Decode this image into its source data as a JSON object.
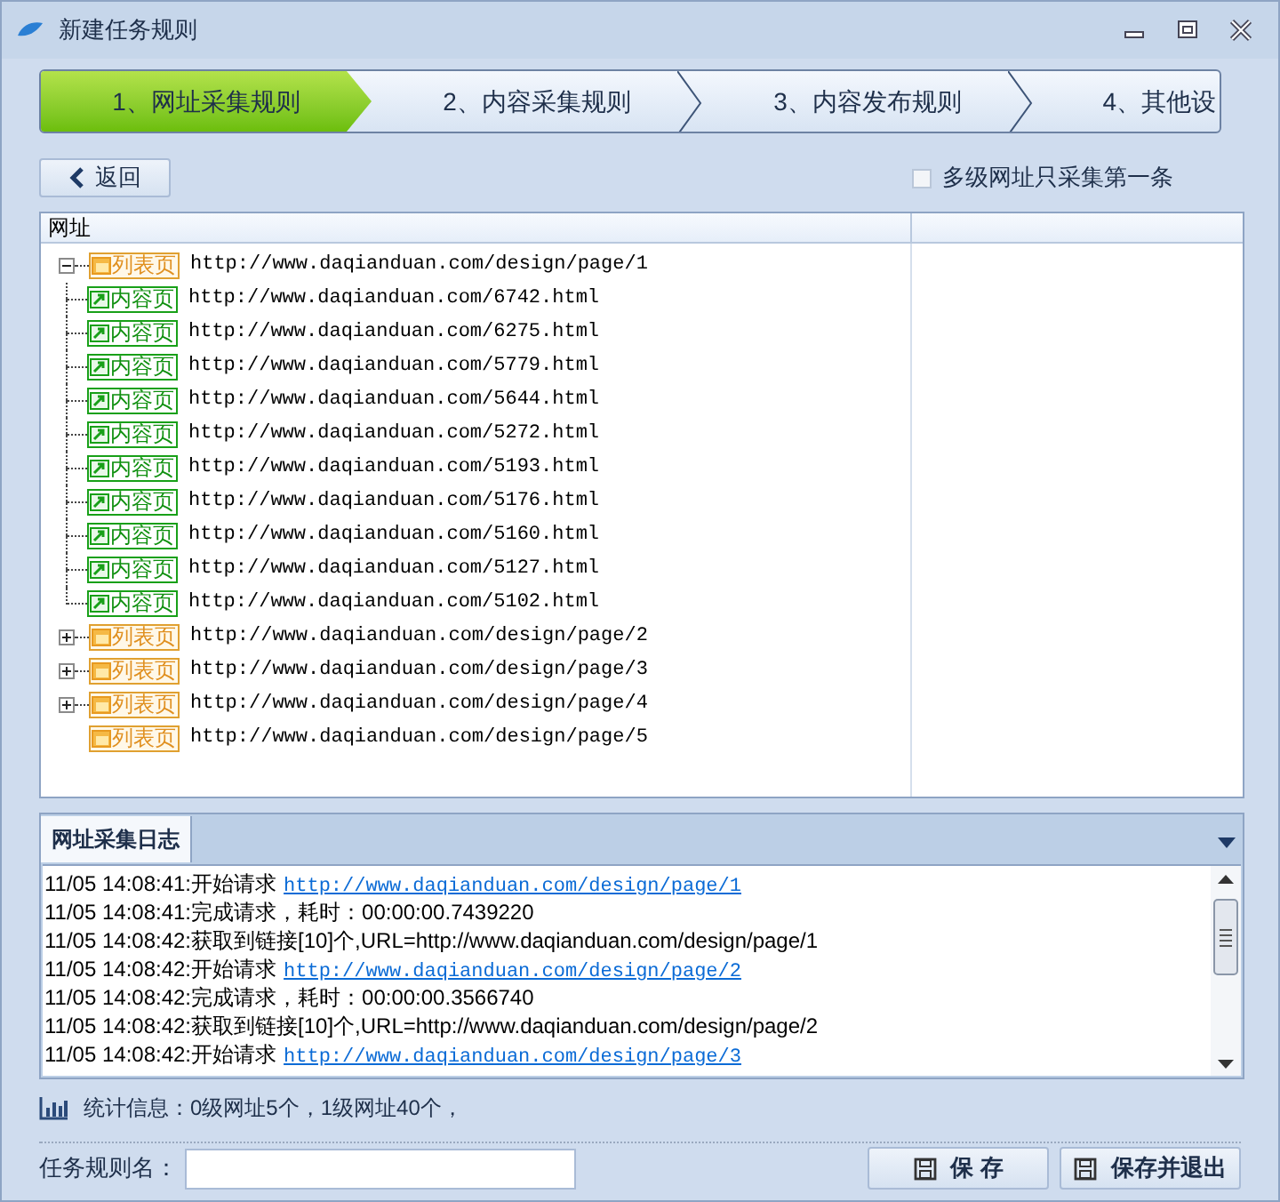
{
  "window": {
    "title": "新建任务规则"
  },
  "steps": [
    {
      "label": "1、网址采集规则",
      "selected": true
    },
    {
      "label": "2、内容采集规则",
      "selected": false
    },
    {
      "label": "3、内容发布规则",
      "selected": false
    },
    {
      "label": "4、其他设",
      "selected": false
    }
  ],
  "back_button": "返回",
  "only_first_checkbox": {
    "label": "多级网址只采集第一条",
    "checked": false
  },
  "tree": {
    "columns": [
      "网址"
    ],
    "nodes": [
      {
        "tag": "列表页",
        "kind": "list",
        "url": "http://www.daqianduan.com/design/page/1",
        "expanded": true,
        "children": [
          {
            "tag": "内容页",
            "kind": "content",
            "url": "http://www.daqianduan.com/6742.html"
          },
          {
            "tag": "内容页",
            "kind": "content",
            "url": "http://www.daqianduan.com/6275.html"
          },
          {
            "tag": "内容页",
            "kind": "content",
            "url": "http://www.daqianduan.com/5779.html"
          },
          {
            "tag": "内容页",
            "kind": "content",
            "url": "http://www.daqianduan.com/5644.html"
          },
          {
            "tag": "内容页",
            "kind": "content",
            "url": "http://www.daqianduan.com/5272.html"
          },
          {
            "tag": "内容页",
            "kind": "content",
            "url": "http://www.daqianduan.com/5193.html"
          },
          {
            "tag": "内容页",
            "kind": "content",
            "url": "http://www.daqianduan.com/5176.html"
          },
          {
            "tag": "内容页",
            "kind": "content",
            "url": "http://www.daqianduan.com/5160.html"
          },
          {
            "tag": "内容页",
            "kind": "content",
            "url": "http://www.daqianduan.com/5127.html"
          },
          {
            "tag": "内容页",
            "kind": "content",
            "url": "http://www.daqianduan.com/5102.html"
          }
        ]
      },
      {
        "tag": "列表页",
        "kind": "list",
        "url": "http://www.daqianduan.com/design/page/2",
        "expanded": false
      },
      {
        "tag": "列表页",
        "kind": "list",
        "url": "http://www.daqianduan.com/design/page/3",
        "expanded": false
      },
      {
        "tag": "列表页",
        "kind": "list",
        "url": "http://www.daqianduan.com/design/page/4",
        "expanded": false
      },
      {
        "tag": "列表页",
        "kind": "list",
        "url": "http://www.daqianduan.com/design/page/5"
      }
    ]
  },
  "log": {
    "tab": "网址采集日志",
    "lines": [
      {
        "text": "11/05 14:08:41:开始请求",
        "link": "http://www.daqianduan.com/design/page/1"
      },
      {
        "text": "11/05 14:08:41:完成请求，耗时：00:00:00.7439220"
      },
      {
        "text": "11/05 14:08:42:获取到链接[10]个,URL=http://www.daqianduan.com/design/page/1"
      },
      {
        "text": "11/05 14:08:42:开始请求",
        "link": "http://www.daqianduan.com/design/page/2"
      },
      {
        "text": "11/05 14:08:42:完成请求，耗时：00:00:00.3566740"
      },
      {
        "text": "11/05 14:08:42:获取到链接[10]个,URL=http://www.daqianduan.com/design/page/2"
      },
      {
        "text": "11/05 14:08:42:开始请求",
        "link": "http://www.daqianduan.com/design/page/3"
      }
    ]
  },
  "stats": "统计信息：0级网址5个，1级网址40个，",
  "rule_name": {
    "label": "任务规则名："
  },
  "buttons": [
    "保 存",
    "保存并退出"
  ]
}
